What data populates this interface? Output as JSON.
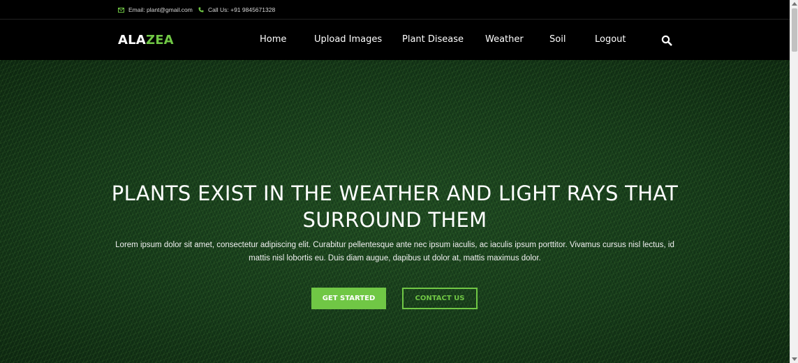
{
  "topbar": {
    "email": "Email: plant@gmail.com",
    "phone": "Call Us: +91 9845671328"
  },
  "nav": {
    "logo_main": "ALA",
    "logo_accent": "ZEA",
    "items": [
      {
        "label": "Home"
      },
      {
        "label": "Upload Images"
      },
      {
        "label": "Plant Disease"
      },
      {
        "label": "Weather"
      },
      {
        "label": "Soil"
      },
      {
        "label": "Logout"
      }
    ],
    "search_icon": "search-icon"
  },
  "hero": {
    "title_line1": "PLANTS EXIST IN THE WEATHER AND LIGHT RAYS THAT",
    "title_line2": "SURROUND THEM",
    "text": "Lorem ipsum dolor sit amet, consectetur adipiscing elit. Curabitur pellentesque ante nec ipsum iaculis, ac iaculis ipsum porttitor. Vivamus cursus nisl lectus, id mattis nisl lobortis eu. Duis diam augue, dapibus ut dolor at, mattis maximus dolor.",
    "primary_button": "GET STARTED",
    "secondary_button": "CONTACT US"
  },
  "colors": {
    "accent": "#70c745",
    "bar_background": "#000000"
  }
}
